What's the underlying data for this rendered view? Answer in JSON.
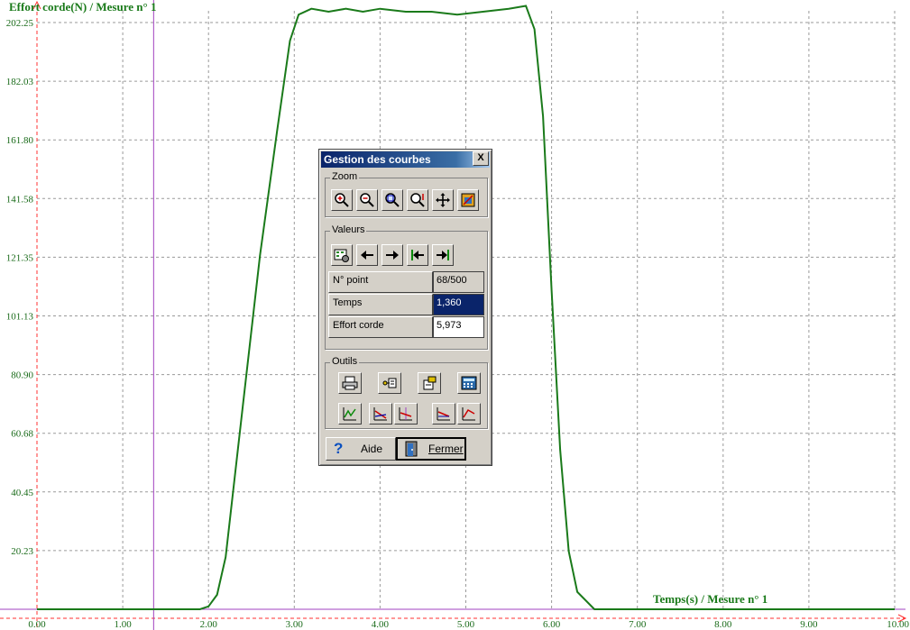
{
  "chart_data": {
    "type": "line",
    "ylabel": "Effort corde(N) / Mesure n° 1",
    "xlabel": "Temps(s) / Mesure n° 1",
    "xlim": [
      0,
      10
    ],
    "ylim": [
      0,
      206.3
    ],
    "x_ticks": [
      "0.00",
      "1.00",
      "2.00",
      "3.00",
      "4.00",
      "5.00",
      "6.00",
      "7.00",
      "8.00",
      "9.00",
      "10.00"
    ],
    "y_ticks": [
      "20.23",
      "40.45",
      "60.68",
      "80.90",
      "101.13",
      "121.35",
      "141.58",
      "161.80",
      "182.03",
      "202.25"
    ],
    "grid": true,
    "cursor_x": 1.36,
    "series": [
      {
        "color": "#1a7a1a",
        "x": [
          0,
          1.9,
          2.0,
          2.1,
          2.2,
          2.4,
          2.6,
          2.8,
          2.95,
          3.05,
          3.2,
          3.4,
          3.6,
          3.8,
          4.0,
          4.3,
          4.6,
          4.9,
          5.2,
          5.5,
          5.7,
          5.8,
          5.9,
          6.0,
          6.1,
          6.2,
          6.3,
          6.5,
          6.7,
          10
        ],
        "y": [
          0,
          0,
          1,
          5,
          18,
          70,
          122,
          165,
          196,
          205,
          207,
          206,
          207,
          206,
          207,
          206,
          206,
          205,
          206,
          207,
          208,
          200,
          170,
          110,
          55,
          20,
          6,
          0,
          0,
          0
        ]
      }
    ],
    "color": "#1a7a1a",
    "grid_color": "#9a9a9a",
    "axis_color": "#ff3030",
    "cursor_color": "#a040c0"
  },
  "dialog": {
    "title": "Gestion des courbes",
    "close_label": "X",
    "zoom_label": "Zoom",
    "values_label": "Valeurs",
    "tools_label": "Outils",
    "rows": [
      {
        "label": "N° point",
        "value": "68/500"
      },
      {
        "label": "Temps",
        "value": "1,360"
      },
      {
        "label": "Effort corde",
        "value": "5,973"
      }
    ],
    "help_label": "Aide",
    "close_button_label": "Fermer"
  }
}
